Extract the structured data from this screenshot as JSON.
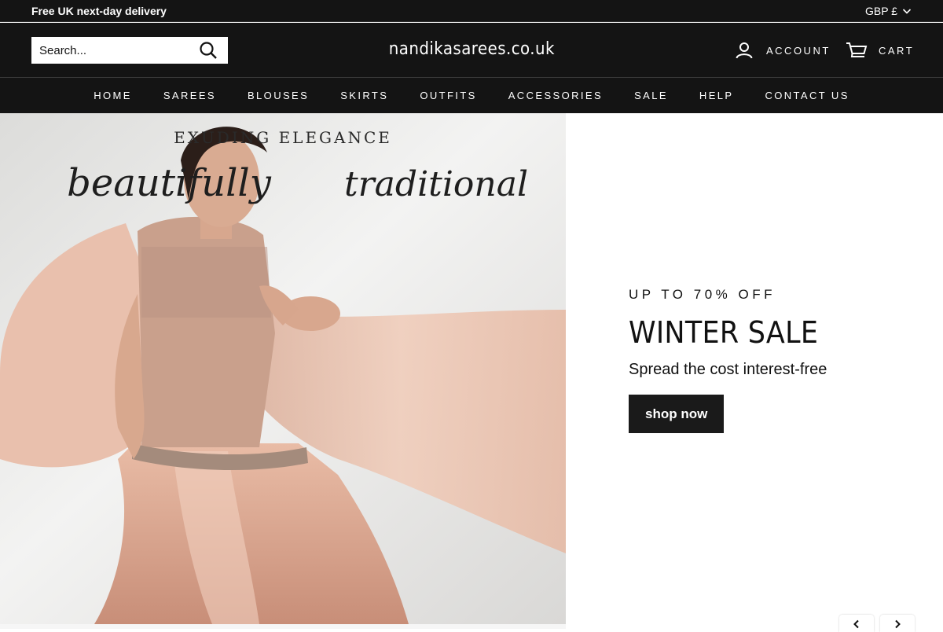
{
  "announcement": {
    "text": "Free UK next-day delivery"
  },
  "currency": {
    "label": "GBP £",
    "icon": "chevron-down-icon"
  },
  "header": {
    "search_placeholder": "Search...",
    "search_icon": "search-icon",
    "logo": "nandikasarees.co.uk",
    "account_label": "ACCOUNT",
    "account_icon": "user-icon",
    "cart_label": "CART",
    "cart_icon": "cart-icon"
  },
  "nav": {
    "items": [
      "HOME",
      "SAREES",
      "BLOUSES",
      "SKIRTS",
      "OUTFITS",
      "ACCESSORIES",
      "SALE",
      "HELP",
      "CONTACT US"
    ]
  },
  "hero": {
    "image_title": "EXUDING ELEGANCE",
    "image_script_left": "beautifully",
    "image_script_right": "traditional",
    "kicker": "UP TO 70% OFF",
    "headline": "WINTER SALE",
    "subtext": "Spread the cost interest-free",
    "cta": "shop now"
  },
  "slider": {
    "prev_icon": "chevron-left-icon",
    "next_icon": "chevron-right-icon"
  },
  "colors": {
    "bar": "#141414",
    "accent": "#1a1a1a",
    "text": "#111111",
    "background": "#ffffff"
  }
}
